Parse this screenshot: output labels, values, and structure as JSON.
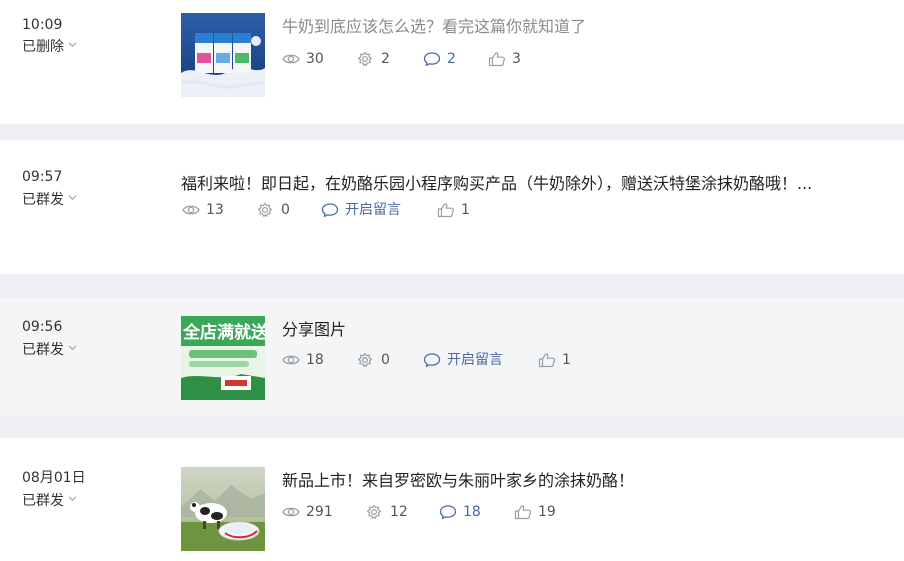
{
  "articles": [
    {
      "time": "10:09",
      "status": "已删除",
      "title": "牛奶到底应该怎么选？看完这篇你就知道了",
      "thumb_icon": "milk-cartons-image",
      "views": "30",
      "shares": "2",
      "comments": "2",
      "likes": "3"
    },
    {
      "time": "09:57",
      "status": "已群发",
      "title": "福利来啦！即日起，在奶酪乐园小程序购买产品（牛奶除外），赠送沃特堡涂抹奶酪哦！...",
      "views": "13",
      "shares": "0",
      "comments": "开启留言",
      "likes": "1"
    },
    {
      "time": "09:56",
      "status": "已群发",
      "title": "分享图片",
      "thumb_icon": "promo-banner-image",
      "thumb_text": "全店满就送",
      "views": "18",
      "shares": "0",
      "comments": "开启留言",
      "likes": "1"
    },
    {
      "time": "08月01日",
      "status": "已群发",
      "title": "新品上市！来自罗密欧与朱丽叶家乡的涂抹奶酪！",
      "thumb_icon": "cow-cheese-image",
      "views": "291",
      "shares": "12",
      "comments": "18",
      "likes": "19"
    }
  ],
  "colors": {
    "separator": "#eef0f3",
    "highlight_row": "#f4f5f7",
    "link_blue": "#4a6aa5",
    "deleted_title": "#8b8b8b"
  }
}
